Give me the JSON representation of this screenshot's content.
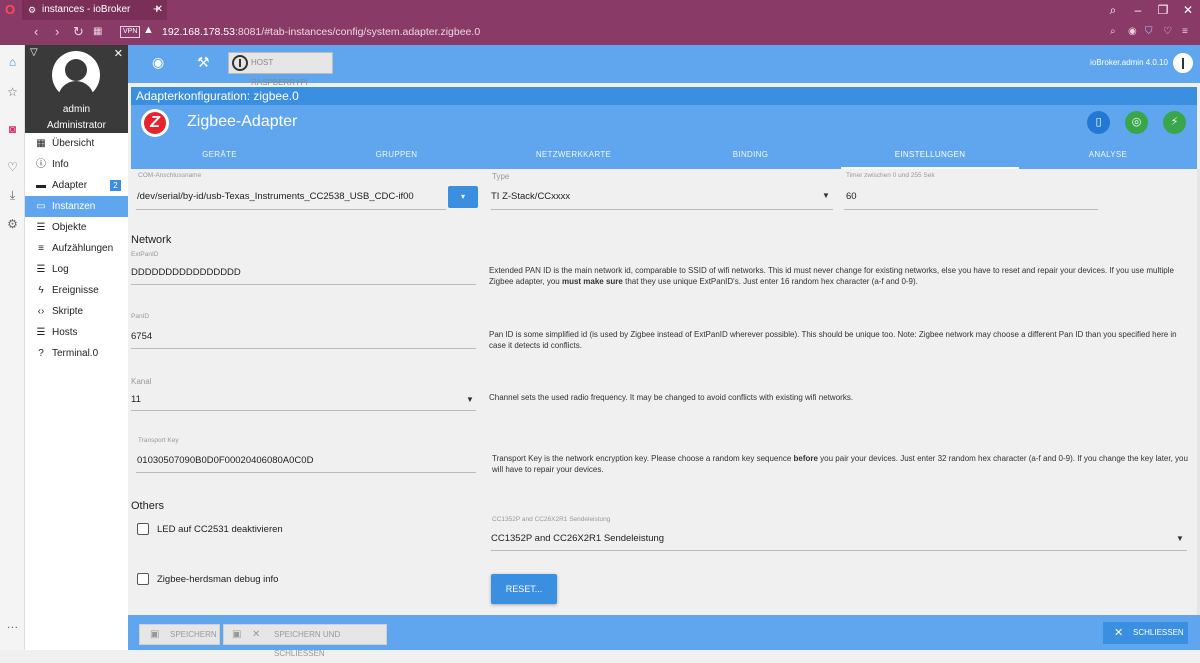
{
  "browser": {
    "tab_title": "instances - ioBroker",
    "vpn": "VPN",
    "url_host": "192.168.178.53",
    "url_rest": ":8081/#tab-instances/config/system.adapter.zigbee.0"
  },
  "sidebar": {
    "user_name": "admin",
    "user_role": "Administrator",
    "items": [
      {
        "label": "Übersicht",
        "icon": "grid-icon"
      },
      {
        "label": "Info",
        "icon": "info-icon"
      },
      {
        "label": "Adapter",
        "icon": "store-icon",
        "badge": "2"
      },
      {
        "label": "Instanzen",
        "icon": "instances-icon",
        "active": true
      },
      {
        "label": "Objekte",
        "icon": "list-icon"
      },
      {
        "label": "Aufzählungen",
        "icon": "enum-icon"
      },
      {
        "label": "Log",
        "icon": "log-icon"
      },
      {
        "label": "Ereignisse",
        "icon": "bolt-icon"
      },
      {
        "label": "Skripte",
        "icon": "code-icon"
      },
      {
        "label": "Hosts",
        "icon": "hosts-icon"
      },
      {
        "label": "Terminal.0",
        "icon": "terminal-icon"
      }
    ]
  },
  "appbar": {
    "host_label": "HOST RASPBERRYPI",
    "version": "ioBroker.admin 4.0.10"
  },
  "dialog": {
    "title": "Adapterkonfiguration: zigbee.0",
    "adapter_name": "Zigbee-Adapter",
    "tabs": [
      "GERÄTE",
      "GRUPPEN",
      "NETZWERKKARTE",
      "BINDING",
      "EINSTELLUNGEN",
      "ANALYSE"
    ],
    "active_tab": "EINSTELLUNGEN"
  },
  "settings": {
    "com_label": "COM-Anschlussname",
    "com_value": "/dev/serial/by-id/usb-Texas_Instruments_CC2538_USB_CDC-if00",
    "type_label": "Type",
    "type_value": "TI Z-Stack/CCxxxx",
    "timer_label": "Timer zwischen 0 und 255 Sek",
    "timer_value": "60",
    "network_heading": "Network",
    "extpanid_label": "ExtPanID",
    "extpanid_value": "DDDDDDDDDDDDDDDD",
    "extpanid_help_1": "Extended PAN ID is the main network id, comparable to SSID of wifi networks. This id must never change for existing networks, else you have to reset and repair your devices. If you use multiple Zigbee adapter, you ",
    "extpanid_help_bold": "must make sure",
    "extpanid_help_2": " that they use unique ExtPanID's. Just enter 16 random hex character (a-f and 0-9).",
    "panid_label": "PanID",
    "panid_value": "6754",
    "panid_help": "Pan ID is some simplified id (is used by Zigbee instead of ExtPanID wherever possible). This should be unique too. Note: Zigbee network may choose a different Pan ID than you specified here in case it detects id conflicts.",
    "kanal_label": "Kanal",
    "kanal_value": "11",
    "kanal_help": "Channel sets the used radio frequency. It may be changed to avoid conflicts with existing wifi networks.",
    "transport_label": "Transport Key",
    "transport_value": "01030507090B0D0F00020406080A0C0D",
    "transport_help_1": "Transport Key is the network encryption key. Please choose a random key sequence ",
    "transport_help_bold": "before",
    "transport_help_2": " you pair your devices. Just enter 32 random hex character (a-f and 0-9). If you change the key later, you will have to repair your devices.",
    "others_heading": "Others",
    "led_label": "LED auf CC2531 deaktivieren",
    "led_checked": false,
    "debug_label": "Zigbee-herdsman debug info",
    "debug_checked": false,
    "cc_label": "CC1352P and CC26X2R1 Sendeleistung",
    "cc_value": "CC1352P and CC26X2R1 Sendeleistung",
    "reset_label": "RESET..."
  },
  "footer": {
    "save_label": "SPEICHERN",
    "save_close_label": "SPEICHERN UND SCHLIESSEN",
    "close_label": "SCHLIESSEN"
  }
}
